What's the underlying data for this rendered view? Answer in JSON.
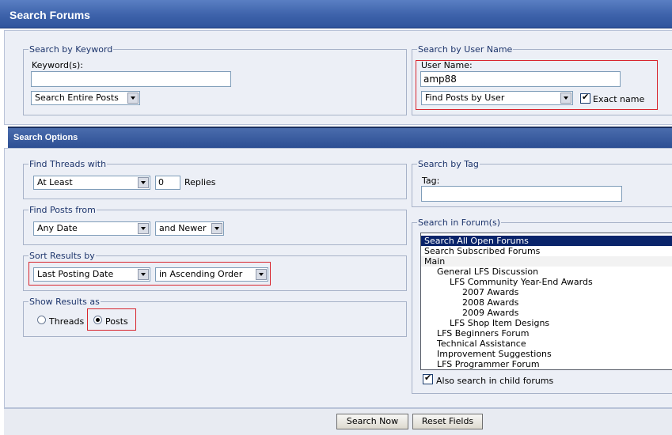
{
  "header": {
    "title": "Search Forums"
  },
  "keyword": {
    "legend": "Search by Keyword",
    "label": "Keyword(s):",
    "value": "",
    "scope_select": "Search Entire Posts"
  },
  "user": {
    "legend": "Search by User Name",
    "label": "User Name:",
    "value": "amp88",
    "mode_select": "Find Posts by User",
    "exact_label": "Exact name",
    "exact_checked": true
  },
  "options": {
    "title": "Search Options",
    "find_threads": {
      "legend": "Find Threads with",
      "select": "At Least",
      "count": "0",
      "suffix": "Replies"
    },
    "find_posts": {
      "legend": "Find Posts from",
      "date_select": "Any Date",
      "range_select": "and Newer"
    },
    "sort": {
      "legend": "Sort Results by",
      "field_select": "Last Posting Date",
      "order_select": "in Ascending Order"
    },
    "show": {
      "legend": "Show Results as",
      "threads_label": "Threads",
      "posts_label": "Posts",
      "selected": "Posts"
    },
    "tag": {
      "legend": "Search by Tag",
      "label": "Tag:",
      "value": ""
    },
    "forums": {
      "legend": "Search in Forum(s)",
      "items": [
        "Search All Open Forums",
        "Search Subscribed Forums",
        "Main",
        "General LFS Discussion",
        "LFS Community Year-End Awards",
        "2007 Awards",
        "2008 Awards",
        "2009 Awards",
        "LFS Shop Item Designs",
        "LFS Beginners Forum",
        "Technical Assistance",
        "Improvement Suggestions",
        "LFS Programmer Forum"
      ],
      "selected_index": 0,
      "child_label": "Also search in child forums",
      "child_checked": true
    }
  },
  "buttons": {
    "search": "Search Now",
    "reset": "Reset Fields"
  }
}
